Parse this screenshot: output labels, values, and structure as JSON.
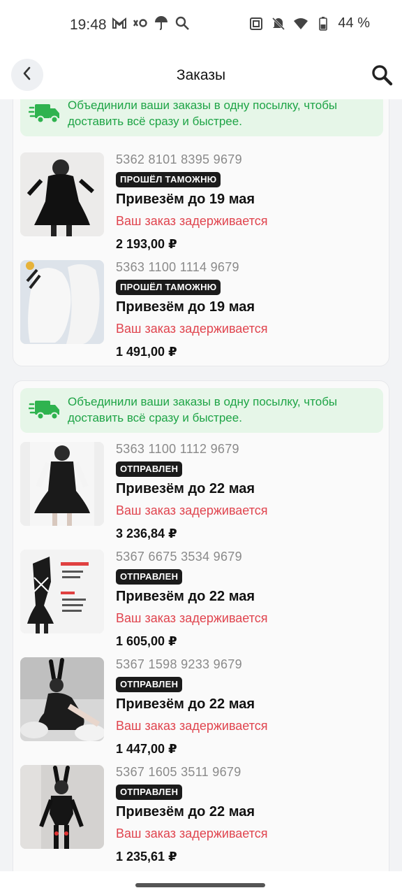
{
  "status_bar": {
    "time": "19:48",
    "battery": "44 %",
    "icons_left": [
      "gmail-icon",
      "app-icon",
      "umbrella-icon",
      "search-icon"
    ],
    "icons_right": [
      "nfc-icon",
      "mute-icon",
      "wifi-icon",
      "battery-icon"
    ]
  },
  "header": {
    "title": "Заказы"
  },
  "groups": [
    {
      "banner": "Объединили ваши заказы в одну посылку, чтобы доставить всё сразу и быстрее.",
      "orders": [
        {
          "number": "5362 8101 8395 9679",
          "status": "ПРОШЁЛ ТАМОЖНЮ",
          "delivery": "Привезём до 19 мая",
          "delay": "Ваш заказ задерживается",
          "price": "2 193,00 ₽"
        },
        {
          "number": "5363 1100 1114 9679",
          "status": "ПРОШЁЛ ТАМОЖНЮ",
          "delivery": "Привезём до 19 мая",
          "delay": "Ваш заказ задерживается",
          "price": "1 491,00 ₽"
        }
      ]
    },
    {
      "banner": "Объединили ваши заказы в одну посылку, чтобы доставить всё сразу и быстрее.",
      "orders": [
        {
          "number": "5363 1100 1112 9679",
          "status": "ОТПРАВЛЕН",
          "delivery": "Привезём до 22 мая",
          "delay": "Ваш заказ задерживается",
          "price": "3 236,84 ₽"
        },
        {
          "number": "5367 6675 3534 9679",
          "status": "ОТПРАВЛЕН",
          "delivery": "Привезём до 22 мая",
          "delay": "Ваш заказ задерживается",
          "price": "1 605,00 ₽"
        },
        {
          "number": "5367 1598 9233 9679",
          "status": "ОТПРАВЛЕН",
          "delivery": "Привезём до 22 мая",
          "delay": "Ваш заказ задерживается",
          "price": "1 447,00 ₽"
        },
        {
          "number": "5367 1605 3511 9679",
          "status": "ОТПРАВЛЕН",
          "delivery": "Привезём до 22 мая",
          "delay": "Ваш заказ задерживается",
          "price": "1 235,61 ₽"
        }
      ]
    }
  ],
  "colors": {
    "banner_bg": "#e6f6e8",
    "banner_text": "#1ea446",
    "delay_text": "#e0444e",
    "badge_bg": "#1b1b1b"
  }
}
